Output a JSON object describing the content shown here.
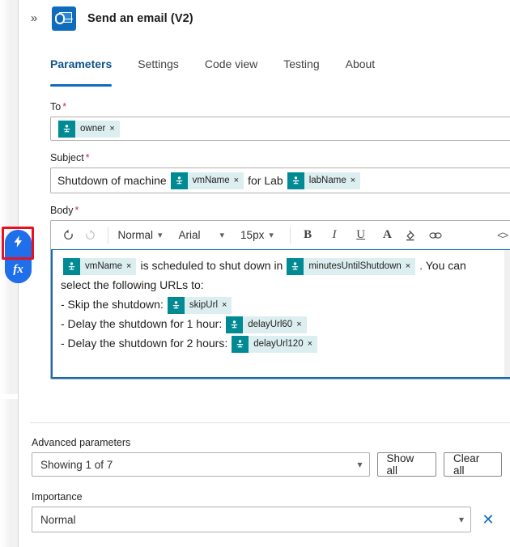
{
  "header": {
    "expand_icon": "chevron-double-right-icon",
    "app_icon": "outlook-icon",
    "title": "Send an email (V2)"
  },
  "tabs": [
    {
      "label": "Parameters",
      "active": true
    },
    {
      "label": "Settings",
      "active": false
    },
    {
      "label": "Code view",
      "active": false
    },
    {
      "label": "Testing",
      "active": false
    },
    {
      "label": "About",
      "active": false
    }
  ],
  "fields": {
    "to": {
      "label": "To",
      "required": "*",
      "tokens": [
        {
          "label": "owner",
          "remove": "×"
        }
      ]
    },
    "subject": {
      "label": "Subject",
      "required": "*",
      "parts": [
        {
          "type": "text",
          "value": "Shutdown of machine"
        },
        {
          "type": "token",
          "value": "vmName",
          "remove": "×"
        },
        {
          "type": "text",
          "value": "for Lab"
        },
        {
          "type": "token",
          "value": "labName",
          "remove": "×"
        }
      ]
    },
    "body": {
      "label": "Body",
      "required": "*",
      "toolbar": {
        "undo": "undo-icon",
        "redo": "redo-icon",
        "style": "Normal",
        "font": "Arial",
        "size": "15px",
        "bold": "B",
        "italic": "I",
        "underline": "U",
        "font_color": "A",
        "highlight": "highlight-icon",
        "link": "link-icon",
        "code": "<>"
      },
      "lines": [
        [
          {
            "type": "token",
            "value": "vmName",
            "remove": "×"
          },
          {
            "type": "text",
            "value": "is scheduled to shut down in"
          },
          {
            "type": "token",
            "value": "minutesUntilShutdown",
            "remove": "×"
          },
          {
            "type": "text",
            "value": ". You can"
          }
        ],
        [
          {
            "type": "text",
            "value": "select the following URLs to:"
          }
        ],
        [
          {
            "type": "text",
            "value": "- Skip the shutdown:"
          },
          {
            "type": "token",
            "value": "skipUrl",
            "remove": "×"
          }
        ],
        [
          {
            "type": "text",
            "value": "- Delay the shutdown for 1 hour:"
          },
          {
            "type": "token",
            "value": "delayUrl60",
            "remove": "×"
          }
        ],
        [
          {
            "type": "text",
            "value": "- Delay the shutdown for 2 hours:"
          },
          {
            "type": "token",
            "value": "delayUrl120",
            "remove": "×"
          }
        ]
      ],
      "scrollbar": {
        "up": "▲",
        "down": "▼"
      }
    }
  },
  "advanced": {
    "label": "Advanced parameters",
    "select_value": "Showing 1 of 7",
    "caret": "chevron-down-icon",
    "show_all_label": "Show all",
    "clear_all_label": "Clear all"
  },
  "importance": {
    "label": "Importance",
    "value": "Normal",
    "caret": "chevron-down-icon",
    "clear": "✕"
  },
  "floating": {
    "dynamic_content": "lightning-bolt-icon",
    "expression": "fx",
    "selection_color": "#e81123"
  },
  "colors": {
    "accent": "#0f6cbd",
    "token_icon": "#008a94",
    "token_bg": "#dceef0",
    "required": "#c4314b",
    "float_button": "#1f6feb"
  }
}
